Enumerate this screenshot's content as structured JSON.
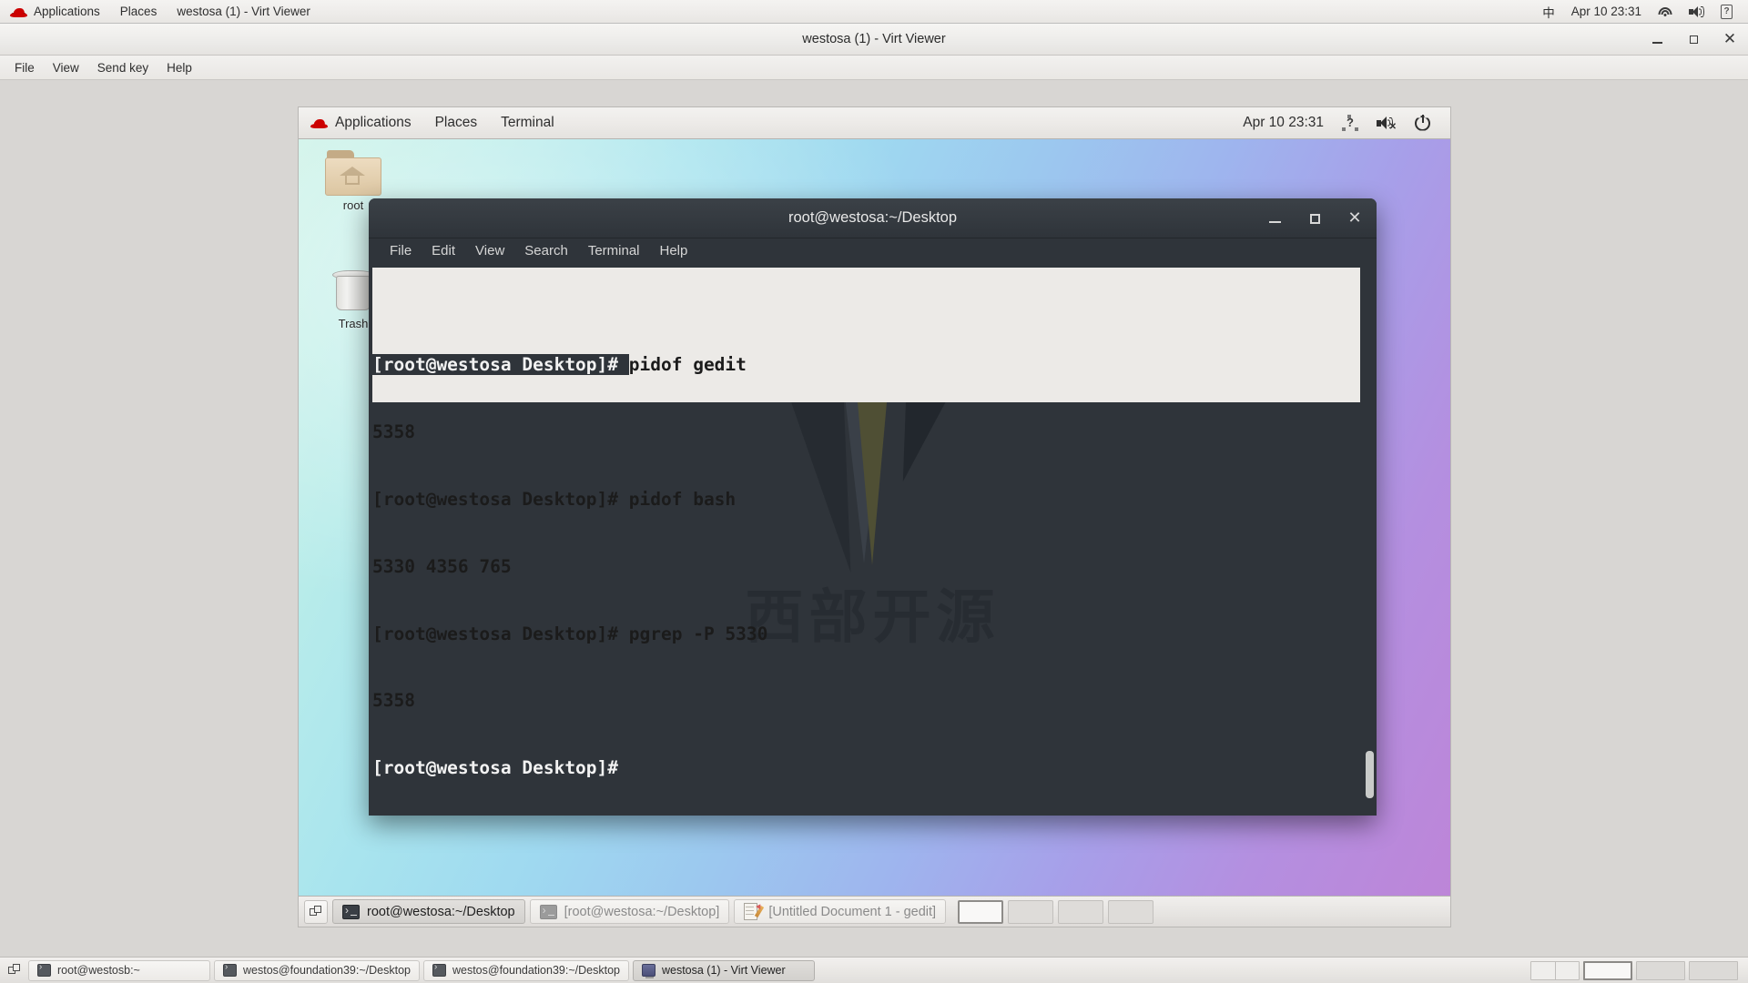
{
  "host_panel": {
    "logo": "redhat-logo",
    "applications": "Applications",
    "places": "Places",
    "window_title": "westosa (1) - Virt Viewer",
    "ime": "中",
    "clock": "Apr 10 23:31",
    "icons": [
      "wifi-icon",
      "volume-icon",
      "help-icon"
    ]
  },
  "virt_viewer": {
    "title": "westosa (1) - Virt Viewer",
    "menu": [
      "File",
      "View",
      "Send key",
      "Help"
    ],
    "window_buttons": [
      "minimize",
      "maximize",
      "close"
    ]
  },
  "vm_panel": {
    "applications": "Applications",
    "places": "Places",
    "terminal": "Terminal",
    "clock": "Apr 10 23:31",
    "icons": [
      "accessibility-icon",
      "volume-muted-icon",
      "power-icon"
    ]
  },
  "desktop_icons": [
    {
      "name": "root-home-folder",
      "label": "root",
      "icon": "folder-home-icon"
    },
    {
      "name": "trash",
      "label": "Trash",
      "icon": "trash-icon"
    }
  ],
  "terminal": {
    "title": "root@westosa:~/Desktop",
    "menu": [
      "File",
      "Edit",
      "View",
      "Search",
      "Terminal",
      "Help"
    ],
    "watermark": "西部开源",
    "prompt": "[root@westosa Desktop]#",
    "lines": [
      {
        "prompt": "[root@westosa Desktop]# ",
        "command": "pidof gedit",
        "inverted_prompt": true,
        "selected": true
      },
      {
        "prompt": "",
        "command": "5358",
        "inverted_prompt": false,
        "selected": true
      },
      {
        "prompt": "[root@westosa Desktop]# ",
        "command": "pidof bash",
        "inverted_prompt": false,
        "selected": true
      },
      {
        "prompt": "",
        "command": "5330 4356 765",
        "inverted_prompt": false,
        "selected": true
      },
      {
        "prompt": "[root@westosa Desktop]# ",
        "command": "pgrep -P 5330",
        "inverted_prompt": false,
        "selected": true
      },
      {
        "prompt": "",
        "command": "5358",
        "inverted_prompt": false,
        "selected": true
      },
      {
        "prompt": "[root@westosa Desktop]#",
        "command": "",
        "inverted_prompt": false,
        "selected": false
      }
    ]
  },
  "vm_taskbar": {
    "show_desktop": "show-desktop-button",
    "tasks": [
      {
        "label": "root@westosa:~/Desktop",
        "icon": "terminal-icon",
        "active": true
      },
      {
        "label": "[root@westosa:~/Desktop]",
        "icon": "terminal-icon",
        "active": false
      },
      {
        "label": "[Untitled Document 1 - gedit]",
        "icon": "gedit-icon",
        "active": false
      }
    ],
    "workspaces": [
      {
        "active": true
      },
      {
        "active": false
      },
      {
        "active": false
      },
      {
        "active": false
      }
    ]
  },
  "host_taskbar": {
    "show_desktop": "show-desktop-button",
    "tasks": [
      {
        "label": "root@westosb:~",
        "icon": "terminal-icon",
        "active": false
      },
      {
        "label": "westos@foundation39:~/Desktop",
        "icon": "terminal-icon",
        "active": false
      },
      {
        "label": "westos@foundation39:~/Desktop",
        "icon": "terminal-icon",
        "active": false
      },
      {
        "label": "westosa (1) - Virt Viewer",
        "icon": "virt-viewer-icon",
        "active": true
      }
    ],
    "workspaces": [
      {
        "active": false,
        "split": true
      },
      {
        "active": true,
        "split": false
      },
      {
        "active": false,
        "split": false
      },
      {
        "active": false,
        "split": false
      }
    ]
  },
  "colors": {
    "terminal_bg": "#2f343a",
    "selection_bg": "#eceae7",
    "accent_red": "#cc0000"
  }
}
